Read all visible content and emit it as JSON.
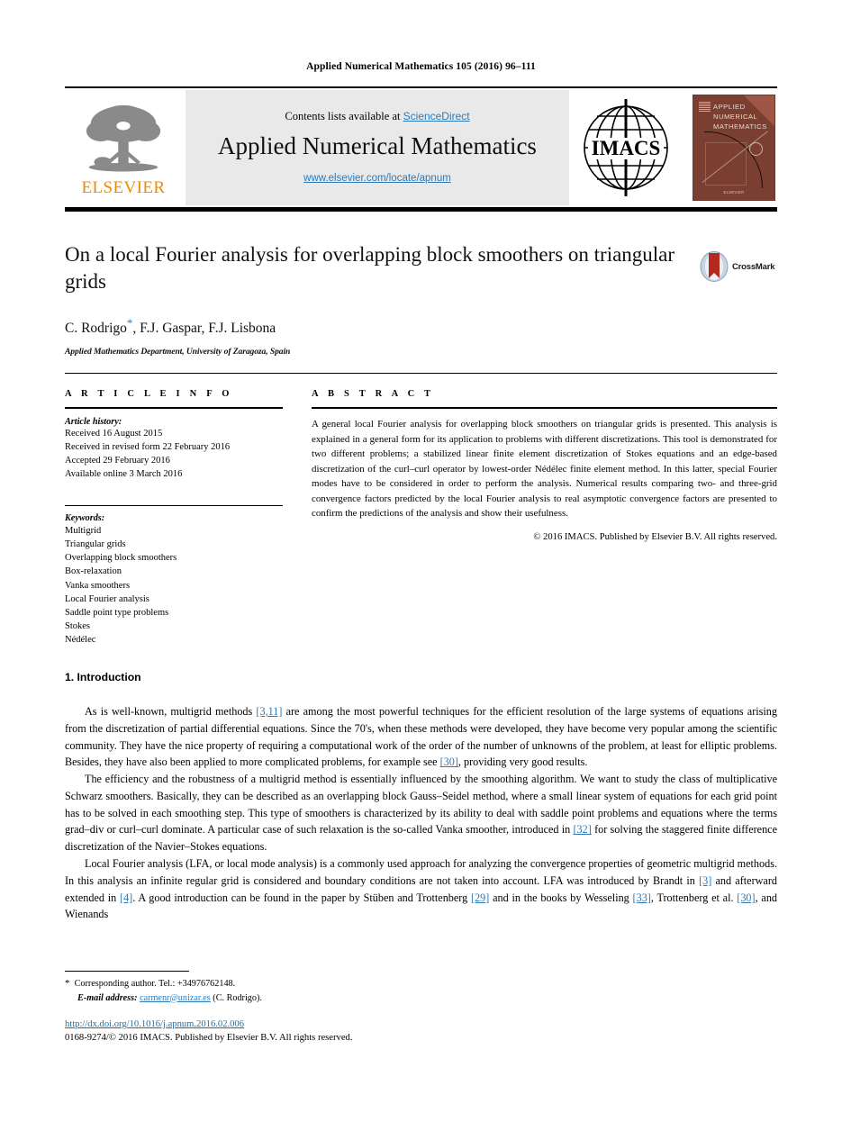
{
  "running_head": "Applied Numerical Mathematics 105 (2016) 96–111",
  "masthead": {
    "elsevier_wordmark": "ELSEVIER",
    "contents_prefix": "Contents lists available at ",
    "contents_link": "ScienceDirect",
    "journal_title": "Applied Numerical Mathematics",
    "journal_url": "www.elsevier.com/locate/apnum",
    "imacs_label": "IMACS",
    "cover_title": "Applied Numerical Mathematics",
    "cover_footer": "ELSEVIER"
  },
  "article": {
    "title": "On a local Fourier analysis for overlapping block smoothers on triangular grids",
    "crossmark_label": "CrossMark",
    "authors": "C. Rodrigo",
    "authors_rest": ", F.J. Gaspar, F.J. Lisbona",
    "author_star": "*",
    "affiliation": "Applied Mathematics Department, University of Zaragoza, Spain"
  },
  "info": {
    "label": "A R T I C L E   I N F O",
    "history_heading": "Article history:",
    "history": [
      "Received 16 August 2015",
      "Received in revised form 22 February 2016",
      "Accepted 29 February 2016",
      "Available online 3 March 2016"
    ],
    "keywords_heading": "Keywords:",
    "keywords": [
      "Multigrid",
      "Triangular grids",
      "Overlapping block smoothers",
      "Box-relaxation",
      "Vanka smoothers",
      "Local Fourier analysis",
      "Saddle point type problems",
      "Stokes",
      "Nédélec"
    ]
  },
  "abstract": {
    "label": "A B S T R A C T",
    "text": "A general local Fourier analysis for overlapping block smoothers on triangular grids is presented. This analysis is explained in a general form for its application to problems with different discretizations. This tool is demonstrated for two different problems; a stabilized linear finite element discretization of Stokes equations and an edge-based discretization of the curl–curl operator by lowest-order Nédélec finite element method. In this latter, special Fourier modes have to be considered in order to perform the analysis. Numerical results comparing two- and three-grid convergence factors predicted by the local Fourier analysis to real asymptotic convergence factors are presented to confirm the predictions of the analysis and show their usefulness.",
    "copyright": "© 2016 IMACS. Published by Elsevier B.V. All rights reserved."
  },
  "body": {
    "section_heading": "1. Introduction",
    "paragraphs": [
      {
        "parts": [
          {
            "t": "As is well-known, multigrid methods "
          },
          {
            "t": "[3,11]",
            "ref": true
          },
          {
            "t": " are among the most powerful techniques for the efficient resolution of the large systems of equations arising from the discretization of partial differential equations. Since the 70's, when these methods were developed, they have become very popular among the scientific community. They have the nice property of requiring a computational work of the order of the number of unknowns of the problem, at least for elliptic problems. Besides, they have also been applied to more complicated problems, for example see "
          },
          {
            "t": "[30]",
            "ref": true
          },
          {
            "t": ", providing very good results."
          }
        ]
      },
      {
        "parts": [
          {
            "t": "The efficiency and the robustness of a multigrid method is essentially influenced by the smoothing algorithm. We want to study the class of multiplicative Schwarz smoothers. Basically, they can be described as an overlapping block Gauss–Seidel method, where a small linear system of equations for each grid point has to be solved in each smoothing step. This type of smoothers is characterized by its ability to deal with saddle point problems and equations where the terms grad–div or curl–curl dominate. A particular case of such relaxation is the so-called Vanka smoother, introduced in "
          },
          {
            "t": "[32]",
            "ref": true
          },
          {
            "t": " for solving the staggered finite difference discretization of the Navier–Stokes equations."
          }
        ]
      },
      {
        "parts": [
          {
            "t": "Local Fourier analysis (LFA, or local mode analysis) is a commonly used approach for analyzing the convergence properties of geometric multigrid methods. In this analysis an infinite regular grid is considered and boundary conditions are not taken into account. LFA was introduced by Brandt in "
          },
          {
            "t": "[3]",
            "ref": true
          },
          {
            "t": " and afterward extended in "
          },
          {
            "t": "[4]",
            "ref": true
          },
          {
            "t": ". A good introduction can be found in the paper by Stüben and Trottenberg "
          },
          {
            "t": "[29]",
            "ref": true
          },
          {
            "t": " and in the books by Wesseling "
          },
          {
            "t": "[33]",
            "ref": true
          },
          {
            "t": ", Trottenberg et al. "
          },
          {
            "t": "[30]",
            "ref": true
          },
          {
            "t": ", and Wienands"
          }
        ]
      }
    ]
  },
  "footer": {
    "corresponding_star": "*",
    "corresponding_text": "Corresponding author. Tel.: +34976762148.",
    "email_label": "E-mail address:",
    "email": "carmenr@unizar.es",
    "email_suffix": " (C. Rodrigo).",
    "doi": "http://dx.doi.org/10.1016/j.apnum.2016.02.006",
    "issn": "0168-9274/© 2016 IMACS. Published by Elsevier B.V. All rights reserved."
  },
  "colors": {
    "link": "#2b7bba",
    "elsevier_orange": "#ed8b00",
    "band_gray": "#e9e9e9",
    "cover_brown": "#7b3f31"
  }
}
